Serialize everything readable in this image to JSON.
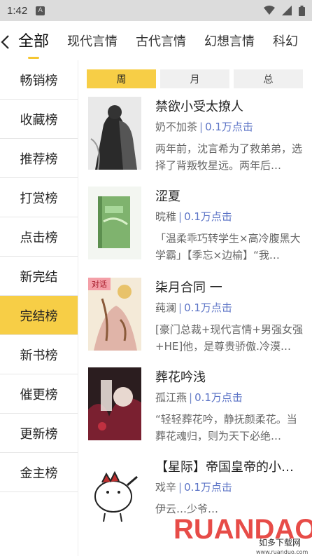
{
  "status_bar": {
    "time": "1:42",
    "app_icon_letter": "A"
  },
  "tabs": [
    "全部",
    "现代言情",
    "古代言情",
    "幻想言情",
    "科幻"
  ],
  "sidebar": {
    "items": [
      "畅销榜",
      "收藏榜",
      "推荐榜",
      "打赏榜",
      "点击榜",
      "新完结",
      "完结榜",
      "新书榜",
      "催更榜",
      "更新榜",
      "金主榜"
    ],
    "active_index": 6
  },
  "periods": {
    "items": [
      "周",
      "月",
      "总"
    ],
    "active_index": 0
  },
  "books": [
    {
      "title": "禁欲小受太撩人",
      "author": "奶不加茶",
      "separator": "|",
      "clicks": "0.1万点击",
      "desc": "两年前，沈言希为了救弟弟，选择了背叛牧星远。两年后…"
    },
    {
      "title": "涩夏",
      "author": "晥稚",
      "separator": "|",
      "clicks": "0.1万点击",
      "desc": "「温柔乖巧转学生×高冷腹黑大学霸」【季忘×边榆】“我…"
    },
    {
      "title": "柒月合同 一",
      "author": "莼澜",
      "separator": "|",
      "clicks": "0.1万点击",
      "desc": "[豪门总裁+现代言情+男强女强+HE]他，是尊贵骄傲.冷漠…",
      "tag": "对话"
    },
    {
      "title": "葬花吟浅",
      "author": "孤江燕",
      "separator": "|",
      "clicks": "0.1万点击",
      "desc": "“轻轻葬花吟，静抚颜柔花。当葬花魂归，则为天下必绝…"
    },
    {
      "title": "【星际】帝国皇帝的小…",
      "author": "戏辛",
      "separator": "|",
      "clicks": "0.1万点击",
      "desc": "伊云…少爷…"
    }
  ],
  "watermark": {
    "brand": "RUANDAO",
    "subtitle": "如多下载网",
    "url": "www.ruanduo.com"
  },
  "colors": {
    "accent": "#f7ce46",
    "clicks": "#5b73c6",
    "status_bar": "#dcdcdc"
  }
}
